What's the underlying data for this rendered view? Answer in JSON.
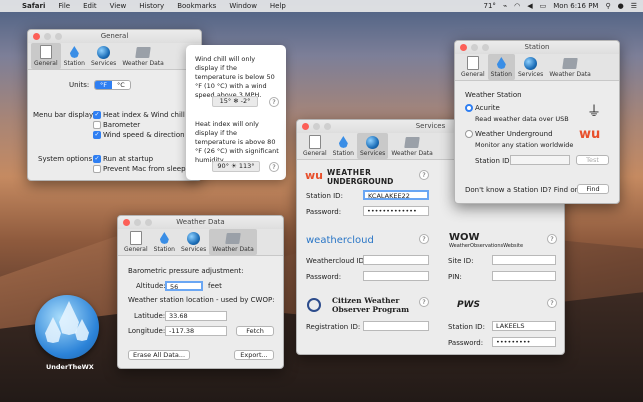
{
  "menubar": {
    "app": "Safari",
    "items": [
      "File",
      "Edit",
      "View",
      "History",
      "Bookmarks",
      "Window",
      "Help"
    ],
    "temperature": "71°",
    "clock": "Mon 6:16 PM"
  },
  "dock": {
    "app_label": "UnderTheWX"
  },
  "general": {
    "title": "General",
    "tabs": [
      "General",
      "Station",
      "Services",
      "Weather Data"
    ],
    "units_label": "Units:",
    "unit_f": "°F",
    "unit_c": "°C",
    "menubar_label": "Menu bar display:",
    "opt_heat": "Heat index & Wind chill",
    "opt_baro": "Barometer",
    "opt_wind": "Wind speed & direction",
    "system_label": "System options:",
    "opt_startup": "Run at startup",
    "opt_sleep": "Prevent Mac from sleeping"
  },
  "popover": {
    "wind_text": "Wind chill will only display if the temperature is below 50 °F (10 °C) with a wind speed above 3 MPH.",
    "wind_example": "15° ❄ -2°",
    "heat_text": "Heat index will only display if the temperature is above 80 °F (26 °C) with significant humidity.",
    "heat_example": "90° ☀ 113°",
    "help": "?"
  },
  "weather_data": {
    "title": "Weather Data",
    "tabs": [
      "General",
      "Station",
      "Services",
      "Weather Data"
    ],
    "baro_label": "Barometric pressure adjustment:",
    "altitude_label": "Altitude:",
    "altitude_value": "56",
    "altitude_unit": "feet",
    "location_label": "Weather station location - used by CWOP:",
    "latitude_label": "Latitude:",
    "latitude_value": "33.68",
    "longitude_label": "Longitude:",
    "longitude_value": "-117.38",
    "fetch": "Fetch",
    "erase": "Erase All Data...",
    "export": "Export..."
  },
  "services": {
    "title": "Services",
    "tabs": [
      "General",
      "Station",
      "Services",
      "Weather Data"
    ],
    "wu_logo_top": "WEATHER",
    "wu_logo_bottom": "UNDERGROUND",
    "wu_station_label": "Station ID:",
    "wu_station_value": "KCALAKEE22",
    "wu_password_label": "Password:",
    "wu_password_value": "•••••••••••••",
    "wc_logo": "weathercloud",
    "wc_id_label": "Weathercloud ID:",
    "wc_password_label": "Password:",
    "wow_logo": "WOW",
    "wow_sub": "WeatherObservationsWebsite",
    "wow_site_label": "Site ID:",
    "wow_pin_label": "PIN:",
    "cwop_logo_top": "Citizen Weather",
    "cwop_logo_bottom": "Observer Program",
    "cwop_reg_label": "Registration ID:",
    "pws_logo": "PWS",
    "pws_station_label": "Station ID:",
    "pws_station_value": "LAKEELS",
    "pws_password_label": "Password:",
    "pws_password_value": "•••••••••",
    "help": "?"
  },
  "station": {
    "title": "Station",
    "tabs": [
      "General",
      "Station",
      "Services",
      "Weather Data"
    ],
    "heading": "Weather Station",
    "acurite": "Acurite",
    "acurite_desc": "Read weather data over USB",
    "wu": "Weather Underground",
    "wu_desc": "Monitor any station worldwide",
    "station_id_label": "Station ID:",
    "test": "Test",
    "dont_know": "Don't know a Station ID?  Find one:",
    "find": "Find"
  }
}
